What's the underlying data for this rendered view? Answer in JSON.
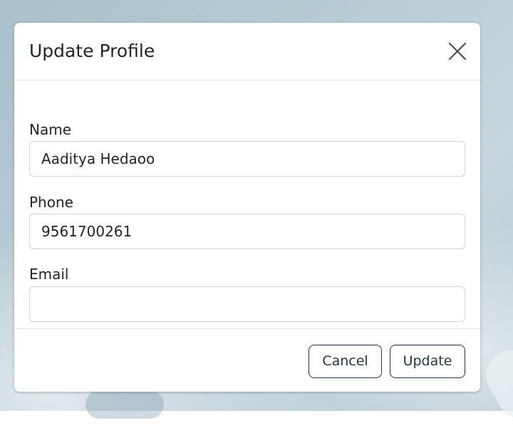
{
  "modal": {
    "title": "Update Profile",
    "close_icon": "close-icon"
  },
  "form": {
    "name": {
      "label": "Name",
      "value": "Aaditya Hedaoo"
    },
    "phone": {
      "label": "Phone",
      "value": "9561700261"
    },
    "email": {
      "label": "Email",
      "value": ""
    }
  },
  "footer": {
    "cancel_label": "Cancel",
    "update_label": "Update"
  },
  "colors": {
    "button_border": "#1f3545",
    "divider": "#dee2e6",
    "input_border": "#ced4da"
  }
}
